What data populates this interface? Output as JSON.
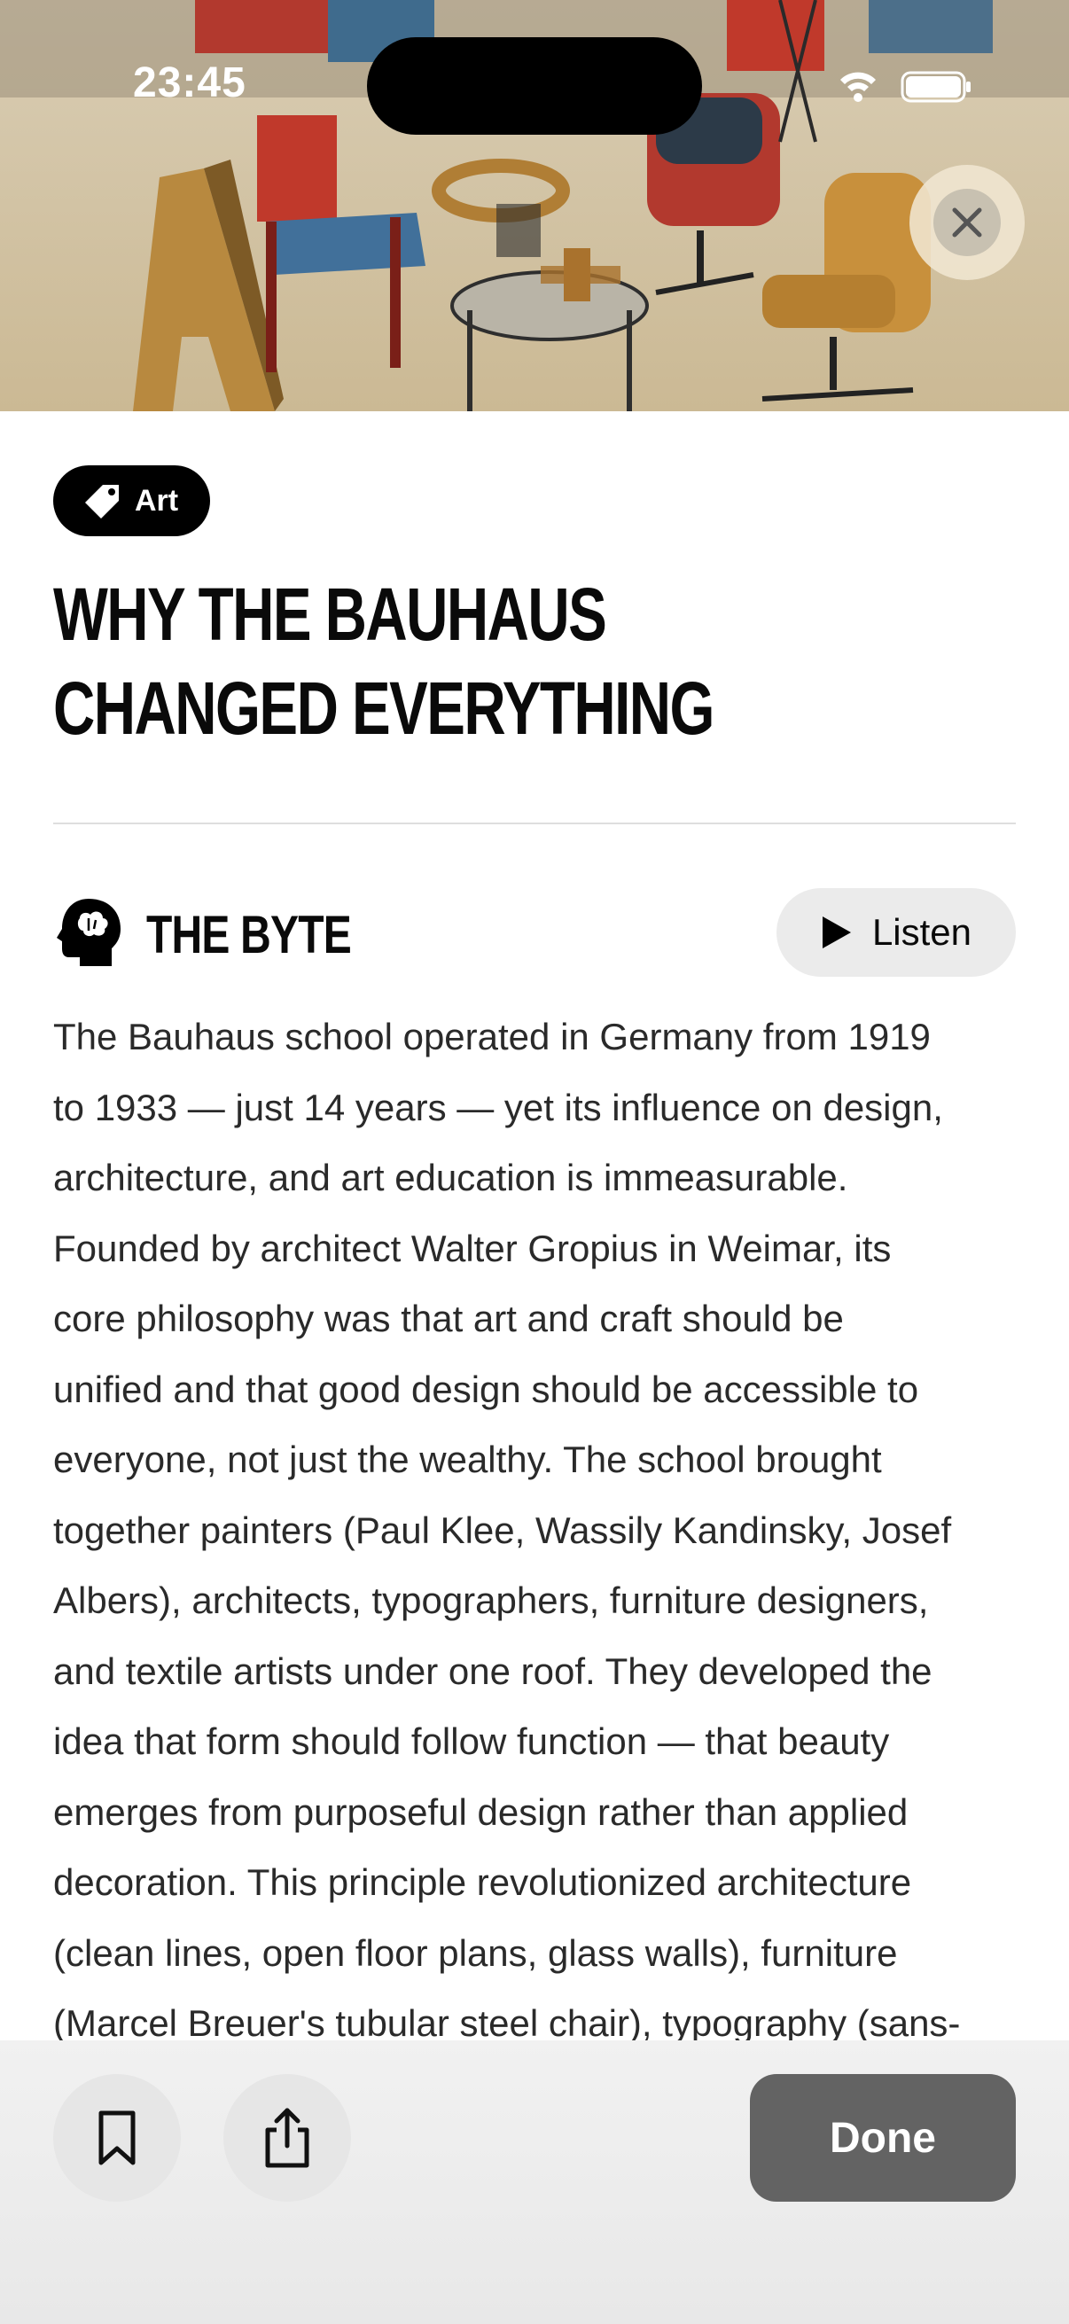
{
  "status_bar": {
    "time": "23:45"
  },
  "hero": {
    "icon": "bauhaus-furniture-illustration"
  },
  "tag": {
    "label": "Art",
    "icon": "tag-icon"
  },
  "article": {
    "title_line1": "WHY THE BAUHAUS",
    "title_line2": "CHANGED EVERYTHING"
  },
  "section": {
    "title": "THE BYTE",
    "icon": "brain-head-icon",
    "listen_label": "Listen",
    "body_lines": [
      "The Bauhaus school operated in Germany from 1919",
      "to 1933 — just 14 years — yet its influence on design,",
      "architecture, and art education is immeasurable.",
      "Founded by architect Walter Gropius in Weimar, its",
      "core philosophy was that art and craft should be",
      "unified and that good design should be accessible to",
      "everyone, not just the wealthy. The school brought",
      "together painters (Paul Klee, Wassily Kandinsky, Josef",
      "Albers), architects, typographers, furniture designers,",
      "and textile artists under one roof. They developed the",
      "idea that form should follow function — that beauty",
      "emerges from purposeful design rather than applied",
      "decoration. This principle revolutionized architecture",
      "(clean lines, open floor plans, glass walls), furniture",
      "(Marcel Breuer's tubular steel chair), typography (sans-"
    ]
  },
  "toolbar": {
    "done_label": "Done"
  },
  "colors": {
    "accent": "#000000",
    "done_button": "#636363"
  }
}
